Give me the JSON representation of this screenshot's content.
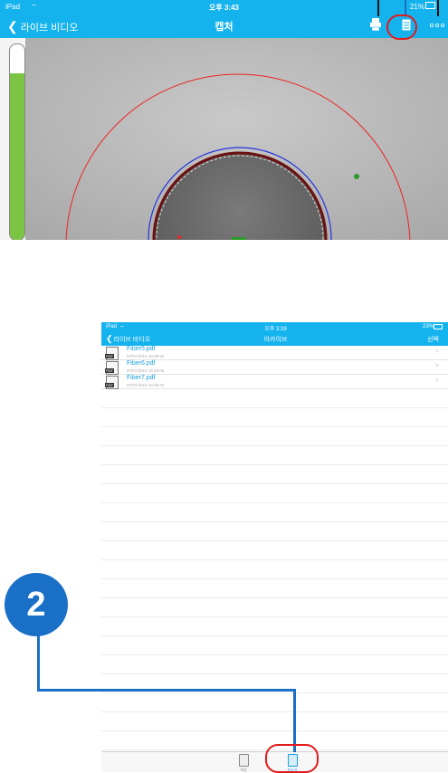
{
  "capture": {
    "status": {
      "device": "iPad",
      "time": "오후 3:43",
      "battery": "21%"
    },
    "nav": {
      "back": "라이브 비디오",
      "title": "캡처"
    },
    "gauge_level": 0.85,
    "toolbar_icons": [
      "print-icon",
      "report-icon",
      "more-icon"
    ]
  },
  "archive": {
    "status": {
      "device": "iPad",
      "time": "오후 3:39",
      "battery": "23%"
    },
    "nav": {
      "back": "라이브 비디오",
      "title": "아카이브",
      "select": "선택"
    },
    "files": [
      {
        "name": "Fiber5.pdf",
        "date": "07/07/2016 19:38:34"
      },
      {
        "name": "Fiber6.pdf",
        "date": "07/07/2016 19:39:08"
      },
      {
        "name": "Fiber7.pdf",
        "date": "07/07/2016 19:39:23"
      }
    ],
    "tabs": [
      {
        "label": "파일",
        "icon": "file-icon"
      },
      {
        "label": "보고서",
        "icon": "report-icon"
      }
    ]
  },
  "callout": {
    "number": "2"
  },
  "colors": {
    "ios_blue": "#15b3ee",
    "callout_blue": "#1a6fc7",
    "highlight_red": "#e21b1b",
    "gauge_green": "#7cc444"
  }
}
